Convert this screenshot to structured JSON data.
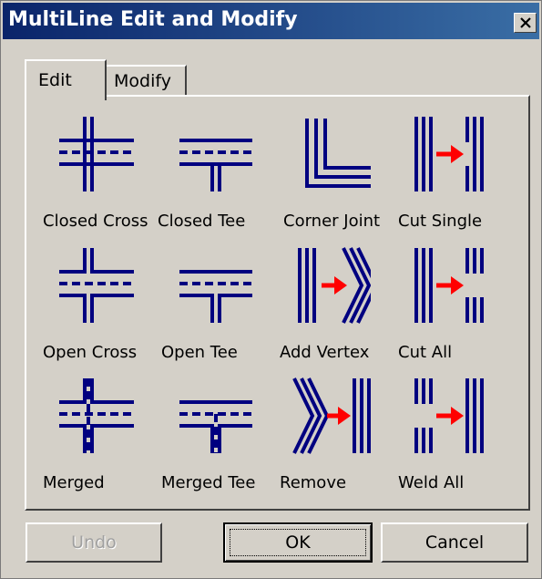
{
  "window": {
    "title": "MultiLine Edit and Modify"
  },
  "tabs": [
    {
      "label": "Edit"
    },
    {
      "label": "Modify"
    }
  ],
  "tools": [
    {
      "label": "Closed Cross",
      "icon": "closed-cross-icon"
    },
    {
      "label": "Closed Tee",
      "icon": "closed-tee-icon"
    },
    {
      "label": "Corner Joint",
      "icon": "corner-joint-icon"
    },
    {
      "label": "Cut Single",
      "icon": "cut-single-icon"
    },
    {
      "label": "Open Cross",
      "icon": "open-cross-icon"
    },
    {
      "label": "Open Tee",
      "icon": "open-tee-icon"
    },
    {
      "label": "Add Vertex",
      "icon": "add-vertex-icon"
    },
    {
      "label": "Cut All",
      "icon": "cut-all-icon"
    },
    {
      "label": "Merged",
      "icon": "merged-cross-icon"
    },
    {
      "label": "Merged Tee",
      "icon": "merged-tee-icon"
    },
    {
      "label": "Remove",
      "icon": "remove-vertex-icon"
    },
    {
      "label": "Weld All",
      "icon": "weld-all-icon"
    }
  ],
  "buttons": {
    "undo": "Undo",
    "ok": "OK",
    "cancel": "Cancel"
  },
  "colors": {
    "line": "#000080",
    "arrow": "#ff0000",
    "face": "#d4d0c8",
    "title": "#0a246a"
  }
}
